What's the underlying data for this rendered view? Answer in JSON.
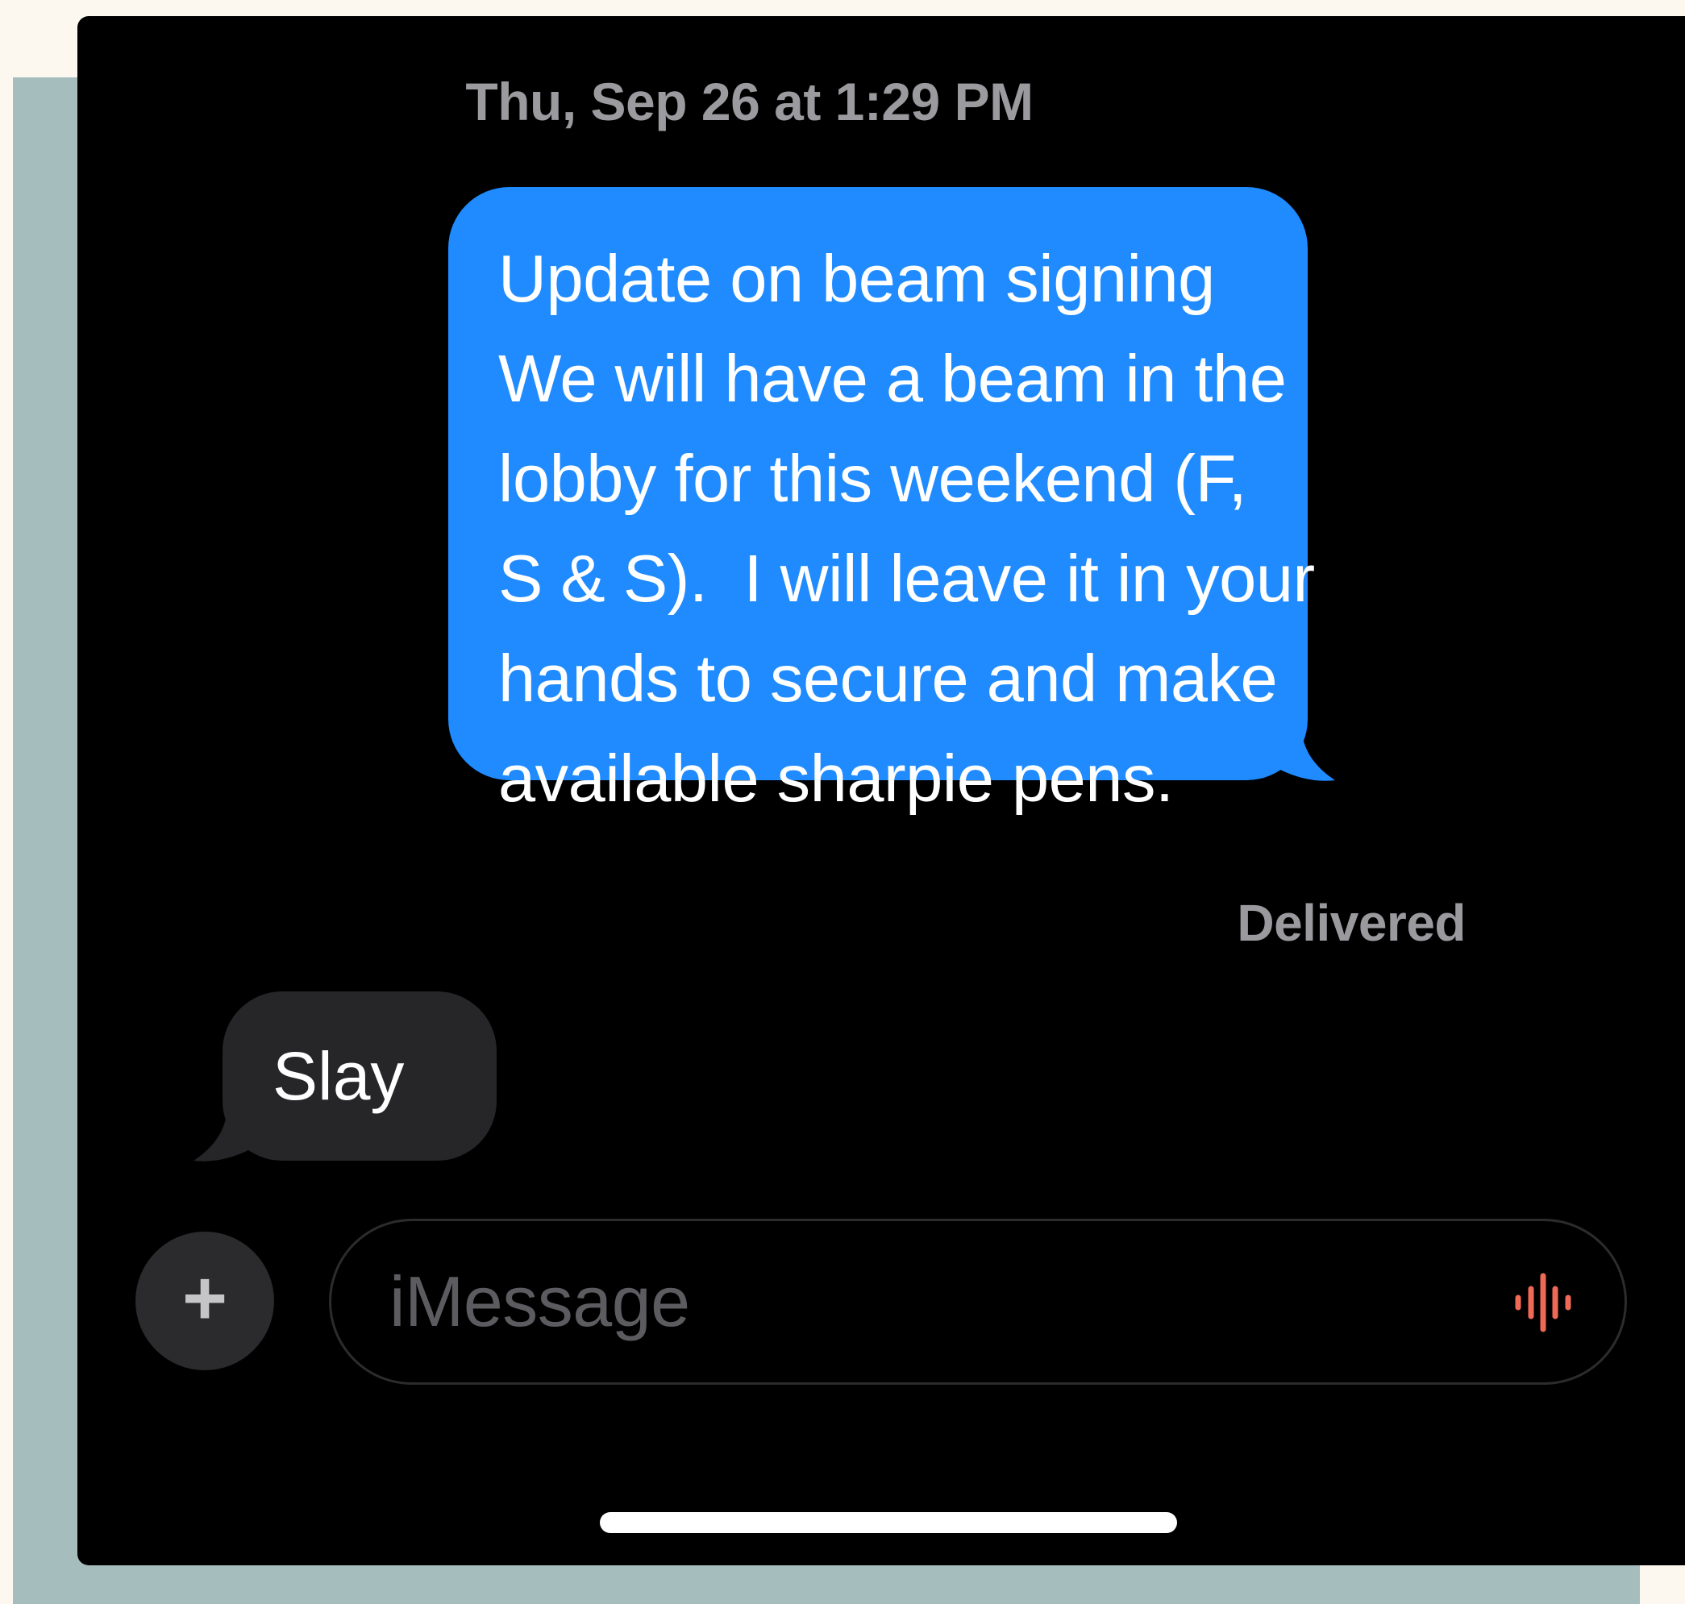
{
  "conversation": {
    "timestamp": "Thu, Sep 26 at 1:29 PM",
    "messages": [
      {
        "direction": "outgoing",
        "text": "Update on beam signing\nWe will have a beam in the\nlobby for this weekend (F,\nS & S).  I will leave it in your\nhands to secure and make\navailable sharpie pens.",
        "status": "Delivered"
      },
      {
        "direction": "incoming",
        "text": "Slay"
      }
    ]
  },
  "composer": {
    "add_button_label": "+",
    "input_placeholder": "iMessage",
    "add_icon": "plus-icon",
    "audio_icon": "audio-waveform-icon"
  },
  "colors": {
    "outgoing_bubble": "#1f8bff",
    "incoming_bubble": "#262628",
    "audio_icon": "#ee6a56",
    "background": "#000000"
  }
}
